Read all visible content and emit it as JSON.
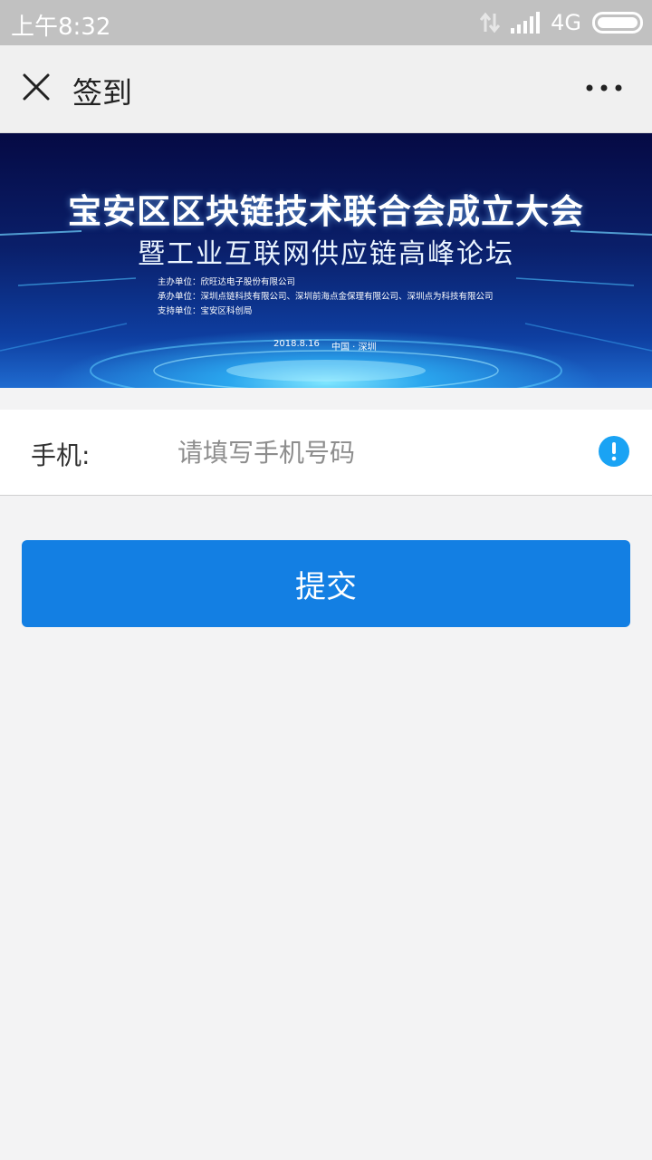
{
  "status_bar": {
    "time": "上午8:32",
    "network": "4G",
    "battery_level": 1.0
  },
  "nav": {
    "title": "签到",
    "close_icon": "close-icon",
    "more_icon": "more-dots-icon"
  },
  "banner": {
    "title_line1": "宝安区区块链技术联合会成立大会",
    "title_line2": "暨工业互联网供应链高峰论坛",
    "organizers": [
      "主办单位：欣旺达电子股份有限公司",
      "承办单位：深圳点链科技有限公司、深圳前海点金保理有限公司、深圳点为科技有限公司",
      "支持单位：宝安区科创局"
    ],
    "date": "2018.8.16",
    "place": "中国 · 深圳"
  },
  "form": {
    "phone_label": "手机:",
    "phone_placeholder": "请填写手机号码",
    "phone_value": "",
    "warning_icon": "exclamation-circle-icon",
    "warning_color": "#1aa3f4"
  },
  "actions": {
    "submit_label": "提交",
    "submit_color": "#137fe3"
  }
}
